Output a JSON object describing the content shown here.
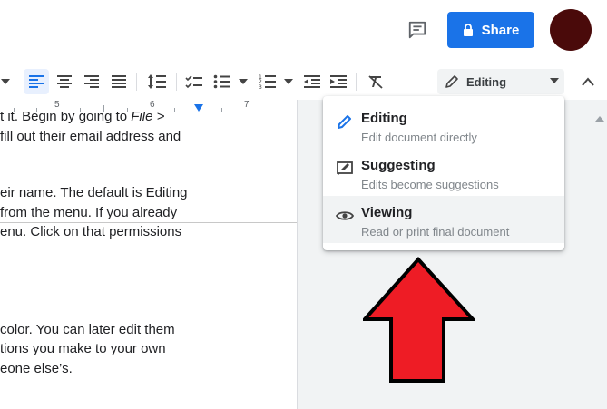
{
  "header": {
    "share_label": "Share"
  },
  "toolbar": {
    "mode_label": "Editing"
  },
  "ruler": {
    "numbers": [
      "5",
      "6",
      "7"
    ]
  },
  "document": {
    "lines": [
      "t it. Begin by going to ",
      "fill out their email address and",
      "eir name. The default is Editing",
      "from the menu. If you already",
      "enu. Click on that permissions",
      "color. You can later edit them",
      "tions you make to your own",
      "eone else’s."
    ],
    "line1_italic": "File >"
  },
  "menu": {
    "items": [
      {
        "title": "Editing",
        "desc": "Edit document directly",
        "icon": "pencil-icon"
      },
      {
        "title": "Suggesting",
        "desc": "Edits become suggestions",
        "icon": "suggest-icon"
      },
      {
        "title": "Viewing",
        "desc": "Read or print final document",
        "icon": "eye-icon"
      }
    ],
    "selected": "Viewing"
  },
  "colors": {
    "share": "#1a73e8",
    "accent": "#1a73e8",
    "avatar": "#4a0a0a",
    "arrow_fill": "#ee1c25"
  }
}
